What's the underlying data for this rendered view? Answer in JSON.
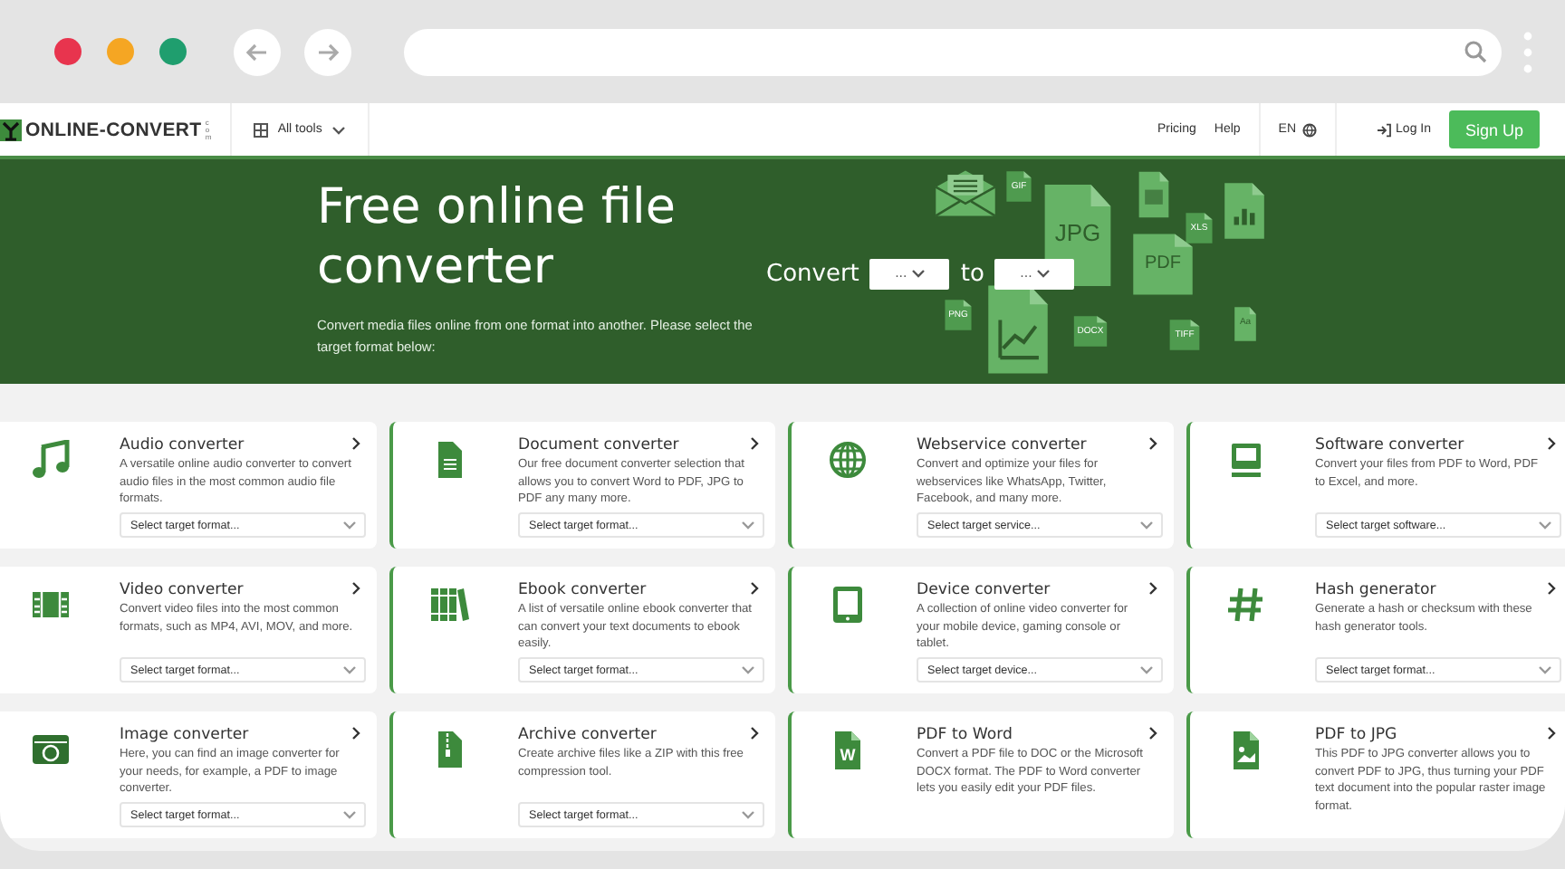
{
  "nav": {
    "logo": "ONLINE-CONVERT",
    "logo_suffix": "com",
    "menu": "All tools",
    "links": [
      "Pricing",
      "Help"
    ],
    "language": "EN",
    "login": "Log In",
    "signup": "Sign Up"
  },
  "hero": {
    "title": "Free online file converter",
    "subtitle": "Convert media files online from one format into another. Please select the target format below:",
    "convert_label": "Convert",
    "from_value": "...",
    "to_label": "to",
    "to_value": "...",
    "file_labels": [
      "GIF",
      "JPG",
      "XLS",
      "PDF",
      "PNG",
      "DOCX",
      "TIFF",
      "Aa"
    ]
  },
  "cards": [
    {
      "kind": "audio",
      "title": "Audio converter",
      "description": "A versatile online audio converter to convert audio files in the most common audio file formats.",
      "placeholder": "Select target format..."
    },
    {
      "kind": "document",
      "title": "Document converter",
      "description": "Our free document converter selection that allows you to convert Word to PDF, JPG to PDF any many more.",
      "placeholder": "Select target format..."
    },
    {
      "kind": "webservice",
      "title": "Webservice converter",
      "description": "Convert and optimize your files for webservices like WhatsApp, Twitter, Facebook, and many more.",
      "placeholder": "Select target service..."
    },
    {
      "kind": "software",
      "title": "Software converter",
      "description": "Convert your files from PDF to Word, PDF to Excel, and more.",
      "placeholder": "Select target software..."
    },
    {
      "kind": "video",
      "title": "Video converter",
      "description": "Convert video files into the most common formats, such as MP4, AVI, MOV, and more.",
      "placeholder": "Select target format..."
    },
    {
      "kind": "ebook",
      "title": "Ebook converter",
      "description": "A list of versatile online ebook converter that can convert your text documents to ebook easily.",
      "placeholder": "Select target format..."
    },
    {
      "kind": "device",
      "title": "Device converter",
      "description": "A collection of online video converter for your mobile device, gaming console or tablet.",
      "placeholder": "Select target device..."
    },
    {
      "kind": "hash",
      "title": "Hash generator",
      "description": "Generate a hash or checksum with these hash generator tools.",
      "placeholder": "Select target format..."
    },
    {
      "kind": "image",
      "title": "Image converter",
      "description": "Here, you can find an image converter for your needs, for example, a PDF to image converter.",
      "placeholder": "Select target format..."
    },
    {
      "kind": "archive",
      "title": "Archive converter",
      "description": "Create archive files like a ZIP with this free compression tool.",
      "placeholder": "Select target format..."
    },
    {
      "kind": "word",
      "title": "PDF to Word",
      "description": "Convert a PDF file to DOC or the Microsoft DOCX format. The PDF to Word converter lets you easily edit your PDF files.",
      "icon_label": "W"
    },
    {
      "kind": "picture-file",
      "title": "PDF to JPG",
      "description": "This PDF to JPG converter allows you to convert PDF to JPG, thus turning your PDF text document into the popular raster image format."
    }
  ]
}
